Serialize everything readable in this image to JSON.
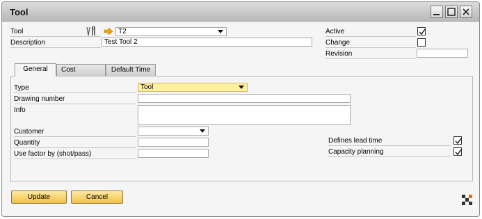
{
  "window": {
    "title": "Tool"
  },
  "header": {
    "tool_label": "Tool",
    "tool_value": "T2",
    "description_label": "Description",
    "description_value": "Test Tool 2",
    "active_label": "Active",
    "active_checked": true,
    "change_label": "Change",
    "change_checked": false,
    "revision_label": "Revision",
    "revision_value": ""
  },
  "tabs": [
    {
      "label": "General",
      "active": true
    },
    {
      "label": "Cost",
      "active": false
    },
    {
      "label": "Default Time",
      "active": false
    }
  ],
  "general": {
    "type_label": "Type",
    "type_value": "Tool",
    "drawing_number_label": "Drawing number",
    "drawing_number_value": "",
    "info_label": "Info",
    "info_value": "",
    "customer_label": "Customer",
    "customer_value": "",
    "quantity_label": "Quantity",
    "quantity_value": "",
    "use_factor_label": "Use factor by (shot/pass)",
    "use_factor_value": "",
    "defines_lead_time_label": "Defines lead time",
    "defines_lead_time_checked": true,
    "capacity_planning_label": "Capacity planning",
    "capacity_planning_checked": true
  },
  "footer": {
    "update_label": "Update",
    "cancel_label": "Cancel"
  },
  "colors": {
    "accent_button": "#f2c14a",
    "highlight_field": "#fff0a0",
    "link_arrow": "#f0a000"
  },
  "icons": [
    "minimize-icon",
    "maximize-icon",
    "close-icon",
    "tools-icon",
    "link-arrow-icon",
    "dropdown-arrow-icon",
    "check-icon",
    "layout-corner-icon"
  ]
}
